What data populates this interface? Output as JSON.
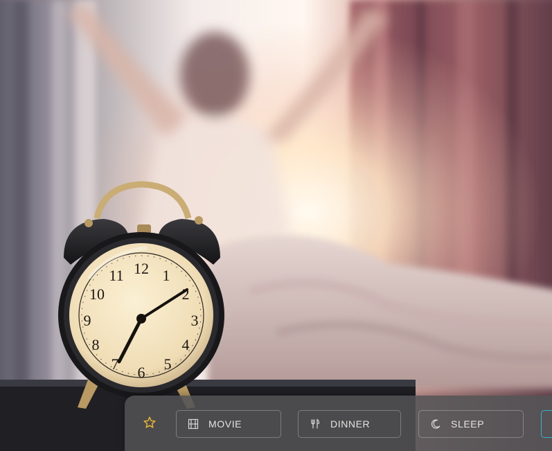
{
  "colors": {
    "favorite_star": "#e8b630",
    "bar_background": "#525254",
    "button_border": "#8a8a8c",
    "button_text": "#e4e4e4",
    "accent_border": "#2fb7c9"
  },
  "scene_bar": {
    "favorite_icon": "star-outline-icon",
    "buttons": [
      {
        "label": "MOVIE",
        "icon": "film-grid-icon"
      },
      {
        "label": "DINNER",
        "icon": "fork-knife-icon"
      },
      {
        "label": "SLEEP",
        "icon": "crescent-moon-icon"
      }
    ]
  },
  "clock": {
    "numerals": [
      "12",
      "1",
      "2",
      "3",
      "4",
      "5",
      "6",
      "7",
      "8",
      "9",
      "10",
      "11"
    ]
  }
}
